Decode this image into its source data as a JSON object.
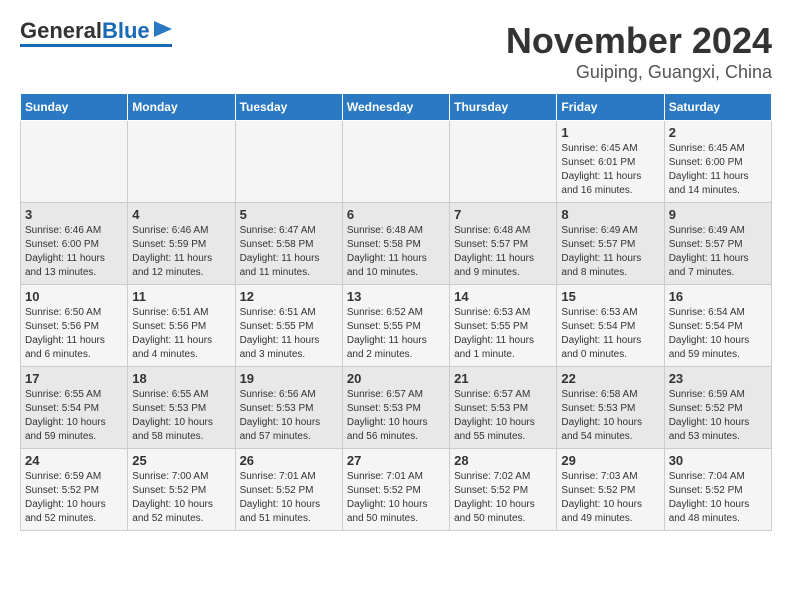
{
  "header": {
    "logo_general": "General",
    "logo_blue": "Blue",
    "title": "November 2024",
    "subtitle": "Guiping, Guangxi, China"
  },
  "days_of_week": [
    "Sunday",
    "Monday",
    "Tuesday",
    "Wednesday",
    "Thursday",
    "Friday",
    "Saturday"
  ],
  "weeks": [
    [
      {
        "day": "",
        "info": ""
      },
      {
        "day": "",
        "info": ""
      },
      {
        "day": "",
        "info": ""
      },
      {
        "day": "",
        "info": ""
      },
      {
        "day": "",
        "info": ""
      },
      {
        "day": "1",
        "info": "Sunrise: 6:45 AM\nSunset: 6:01 PM\nDaylight: 11 hours and 16 minutes."
      },
      {
        "day": "2",
        "info": "Sunrise: 6:45 AM\nSunset: 6:00 PM\nDaylight: 11 hours and 14 minutes."
      }
    ],
    [
      {
        "day": "3",
        "info": "Sunrise: 6:46 AM\nSunset: 6:00 PM\nDaylight: 11 hours and 13 minutes."
      },
      {
        "day": "4",
        "info": "Sunrise: 6:46 AM\nSunset: 5:59 PM\nDaylight: 11 hours and 12 minutes."
      },
      {
        "day": "5",
        "info": "Sunrise: 6:47 AM\nSunset: 5:58 PM\nDaylight: 11 hours and 11 minutes."
      },
      {
        "day": "6",
        "info": "Sunrise: 6:48 AM\nSunset: 5:58 PM\nDaylight: 11 hours and 10 minutes."
      },
      {
        "day": "7",
        "info": "Sunrise: 6:48 AM\nSunset: 5:57 PM\nDaylight: 11 hours and 9 minutes."
      },
      {
        "day": "8",
        "info": "Sunrise: 6:49 AM\nSunset: 5:57 PM\nDaylight: 11 hours and 8 minutes."
      },
      {
        "day": "9",
        "info": "Sunrise: 6:49 AM\nSunset: 5:57 PM\nDaylight: 11 hours and 7 minutes."
      }
    ],
    [
      {
        "day": "10",
        "info": "Sunrise: 6:50 AM\nSunset: 5:56 PM\nDaylight: 11 hours and 6 minutes."
      },
      {
        "day": "11",
        "info": "Sunrise: 6:51 AM\nSunset: 5:56 PM\nDaylight: 11 hours and 4 minutes."
      },
      {
        "day": "12",
        "info": "Sunrise: 6:51 AM\nSunset: 5:55 PM\nDaylight: 11 hours and 3 minutes."
      },
      {
        "day": "13",
        "info": "Sunrise: 6:52 AM\nSunset: 5:55 PM\nDaylight: 11 hours and 2 minutes."
      },
      {
        "day": "14",
        "info": "Sunrise: 6:53 AM\nSunset: 5:55 PM\nDaylight: 11 hours and 1 minute."
      },
      {
        "day": "15",
        "info": "Sunrise: 6:53 AM\nSunset: 5:54 PM\nDaylight: 11 hours and 0 minutes."
      },
      {
        "day": "16",
        "info": "Sunrise: 6:54 AM\nSunset: 5:54 PM\nDaylight: 10 hours and 59 minutes."
      }
    ],
    [
      {
        "day": "17",
        "info": "Sunrise: 6:55 AM\nSunset: 5:54 PM\nDaylight: 10 hours and 59 minutes."
      },
      {
        "day": "18",
        "info": "Sunrise: 6:55 AM\nSunset: 5:53 PM\nDaylight: 10 hours and 58 minutes."
      },
      {
        "day": "19",
        "info": "Sunrise: 6:56 AM\nSunset: 5:53 PM\nDaylight: 10 hours and 57 minutes."
      },
      {
        "day": "20",
        "info": "Sunrise: 6:57 AM\nSunset: 5:53 PM\nDaylight: 10 hours and 56 minutes."
      },
      {
        "day": "21",
        "info": "Sunrise: 6:57 AM\nSunset: 5:53 PM\nDaylight: 10 hours and 55 minutes."
      },
      {
        "day": "22",
        "info": "Sunrise: 6:58 AM\nSunset: 5:53 PM\nDaylight: 10 hours and 54 minutes."
      },
      {
        "day": "23",
        "info": "Sunrise: 6:59 AM\nSunset: 5:52 PM\nDaylight: 10 hours and 53 minutes."
      }
    ],
    [
      {
        "day": "24",
        "info": "Sunrise: 6:59 AM\nSunset: 5:52 PM\nDaylight: 10 hours and 52 minutes."
      },
      {
        "day": "25",
        "info": "Sunrise: 7:00 AM\nSunset: 5:52 PM\nDaylight: 10 hours and 52 minutes."
      },
      {
        "day": "26",
        "info": "Sunrise: 7:01 AM\nSunset: 5:52 PM\nDaylight: 10 hours and 51 minutes."
      },
      {
        "day": "27",
        "info": "Sunrise: 7:01 AM\nSunset: 5:52 PM\nDaylight: 10 hours and 50 minutes."
      },
      {
        "day": "28",
        "info": "Sunrise: 7:02 AM\nSunset: 5:52 PM\nDaylight: 10 hours and 50 minutes."
      },
      {
        "day": "29",
        "info": "Sunrise: 7:03 AM\nSunset: 5:52 PM\nDaylight: 10 hours and 49 minutes."
      },
      {
        "day": "30",
        "info": "Sunrise: 7:04 AM\nSunset: 5:52 PM\nDaylight: 10 hours and 48 minutes."
      }
    ]
  ]
}
